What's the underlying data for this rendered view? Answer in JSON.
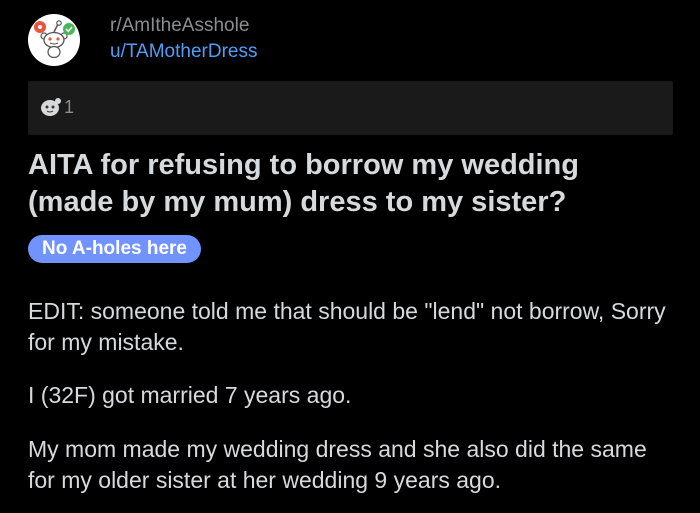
{
  "header": {
    "subreddit": "r/AmItheAsshole",
    "username": "u/TAMotherDress",
    "avatar_icon": "reddit-snoo-icon"
  },
  "awards": {
    "icon": "award-icon",
    "count": "1"
  },
  "post": {
    "title": "AITA for refusing to borrow my wedding (made by my mum) dress to my sister?",
    "flair": "No A-holes here",
    "flair_color": "#7193ff",
    "paragraphs": [
      "EDIT: someone told me that should be \"lend\" not borrow, Sorry for my mistake.",
      "I (32F) got married 7 years ago.",
      "My mom made my wedding dress and she also did the same for my older sister at her wedding 9 years ago."
    ]
  },
  "colors": {
    "background": "#000000",
    "text": "#d7dadc",
    "muted": "#8b8d90",
    "link": "#4f9ef8",
    "award_bar": "#1a1a1b"
  }
}
